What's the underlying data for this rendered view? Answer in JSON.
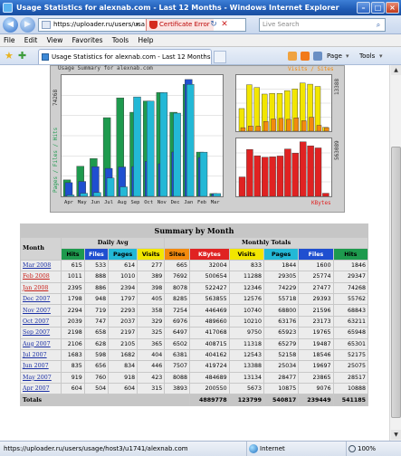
{
  "window": {
    "title": "Usage Statistics for alexnab.com - Last 12 Months - Windows Internet Explorer"
  },
  "address": {
    "url": "https://uploader.ru/users/usa",
    "cert_error": "Certificate Error",
    "search_placeholder": "Live Search"
  },
  "menu": [
    "File",
    "Edit",
    "View",
    "Favorites",
    "Tools",
    "Help"
  ],
  "tab": {
    "label": "Usage Statistics for alexnab.com - Last 12 Months"
  },
  "toolbar": {
    "page_label": "Page",
    "tools_label": "Tools"
  },
  "graph": {
    "title": "Usage Summary for alexnab.com",
    "left_axis_label": "Pages / Files / Hits",
    "left_max_label": "74268",
    "right_top_max_label": "13388",
    "right_bottom_max_label": "563089",
    "right_top_legend": "Visits / Sites",
    "kbytes_label": "KBytes",
    "months": [
      "Apr",
      "May",
      "Jun",
      "Jul",
      "Aug",
      "Sep",
      "Oct",
      "Nov",
      "Dec",
      "Jan",
      "Feb",
      "Mar"
    ],
    "series": {
      "hits": [
        10888,
        19924,
        25075,
        52175,
        65301,
        55762,
        63211,
        68843,
        55762,
        74268,
        29347,
        1846
      ],
      "files": [
        9076,
        9866,
        19697,
        18546,
        19487,
        19765,
        23173,
        21596,
        29393,
        77477,
        25774,
        1600
      ],
      "pages": [
        875,
        2035,
        2504,
        12158,
        6279,
        65923,
        63176,
        68800,
        55178,
        74229,
        29305,
        1844
      ],
      "visits": [
        3893,
        7988,
        7507,
        6381,
        6502,
        6497,
        6976,
        7254,
        8285,
        8078,
        7692,
        665
      ],
      "sites": [
        604,
        899,
        855,
        1683,
        2106,
        2198,
        2039,
        2294,
        1798,
        2395,
        1011,
        615
      ],
      "kbytes": [
        200550,
        484689,
        419724,
        404162,
        408715,
        417068,
        489660,
        446469,
        563855,
        522427,
        500654,
        32004
      ]
    },
    "colors": {
      "hits": "#1e9a4e",
      "files": "#1f4fd0",
      "pages": "#23b8d6",
      "visits": "#f2e600",
      "sites": "#f28a0e",
      "kbytes": "#e02222",
      "bg": "#cfcfcf"
    }
  },
  "summary": {
    "caption": "Summary by Month",
    "month_header": "Month",
    "daily_avg_header": "Daily Avg",
    "monthly_totals_header": "Monthly Totals",
    "daily_cols": [
      "Hits",
      "Files",
      "Pages",
      "Visits"
    ],
    "monthly_cols": [
      "Sites",
      "KBytes",
      "Visits",
      "Pages",
      "Files",
      "Hits"
    ],
    "rows": [
      {
        "month": "Mar 2008",
        "hits": "615",
        "files": "533",
        "pages": "614",
        "visits": "277",
        "sites": "665",
        "kbytes": "32004",
        "m_visits": "833",
        "m_pages": "1844",
        "m_files": "1600",
        "m_hits": "1846",
        "red": false
      },
      {
        "month": "Feb 2008",
        "hits": "1011",
        "files": "888",
        "pages": "1010",
        "visits": "389",
        "sites": "7692",
        "kbytes": "500654",
        "m_visits": "11288",
        "m_pages": "29305",
        "m_files": "25774",
        "m_hits": "29347",
        "red": true
      },
      {
        "month": "Jan 2008",
        "hits": "2395",
        "files": "886",
        "pages": "2394",
        "visits": "398",
        "sites": "8078",
        "kbytes": "522427",
        "m_visits": "12346",
        "m_pages": "74229",
        "m_files": "27477",
        "m_hits": "74268",
        "red": true
      },
      {
        "month": "Dec 2007",
        "hits": "1798",
        "files": "948",
        "pages": "1797",
        "visits": "405",
        "sites": "8285",
        "kbytes": "563855",
        "m_visits": "12576",
        "m_pages": "55718",
        "m_files": "29393",
        "m_hits": "55762",
        "red": false
      },
      {
        "month": "Nov 2007",
        "hits": "2294",
        "files": "719",
        "pages": "2293",
        "visits": "358",
        "sites": "7254",
        "kbytes": "446469",
        "m_visits": "10740",
        "m_pages": "68800",
        "m_files": "21596",
        "m_hits": "68843",
        "red": false
      },
      {
        "month": "Oct 2007",
        "hits": "2039",
        "files": "747",
        "pages": "2037",
        "visits": "329",
        "sites": "6976",
        "kbytes": "489660",
        "m_visits": "10210",
        "m_pages": "63176",
        "m_files": "23173",
        "m_hits": "63211",
        "red": false
      },
      {
        "month": "Sep 2007",
        "hits": "2198",
        "files": "658",
        "pages": "2197",
        "visits": "325",
        "sites": "6497",
        "kbytes": "417068",
        "m_visits": "9750",
        "m_pages": "65923",
        "m_files": "19765",
        "m_hits": "65948",
        "red": false
      },
      {
        "month": "Aug 2007",
        "hits": "2106",
        "files": "628",
        "pages": "2105",
        "visits": "365",
        "sites": "6502",
        "kbytes": "408715",
        "m_visits": "11318",
        "m_pages": "65279",
        "m_files": "19487",
        "m_hits": "65301",
        "red": false
      },
      {
        "month": "Jul 2007",
        "hits": "1683",
        "files": "598",
        "pages": "1682",
        "visits": "404",
        "sites": "6381",
        "kbytes": "404162",
        "m_visits": "12543",
        "m_pages": "52158",
        "m_files": "18546",
        "m_hits": "52175",
        "red": false
      },
      {
        "month": "Jun 2007",
        "hits": "835",
        "files": "656",
        "pages": "834",
        "visits": "446",
        "sites": "7507",
        "kbytes": "419724",
        "m_visits": "13388",
        "m_pages": "25034",
        "m_files": "19697",
        "m_hits": "25075",
        "red": false
      },
      {
        "month": "May 2007",
        "hits": "919",
        "files": "760",
        "pages": "918",
        "visits": "423",
        "sites": "8088",
        "kbytes": "484689",
        "m_visits": "13134",
        "m_pages": "28477",
        "m_files": "23865",
        "m_hits": "28517",
        "red": false
      },
      {
        "month": "Apr 2007",
        "hits": "604",
        "files": "504",
        "pages": "604",
        "visits": "315",
        "sites": "3893",
        "kbytes": "200550",
        "m_visits": "5673",
        "m_pages": "10875",
        "m_files": "9076",
        "m_hits": "10888",
        "red": false
      }
    ],
    "totals": {
      "label": "Totals",
      "kbytes": "4889778",
      "visits": "123799",
      "pages": "540817",
      "files": "239449",
      "hits": "541185"
    }
  },
  "status": {
    "url": "https://uploader.ru/users/usage/host3/u1741/alexnab.com",
    "zone": "Internet",
    "zoom": "100%"
  }
}
